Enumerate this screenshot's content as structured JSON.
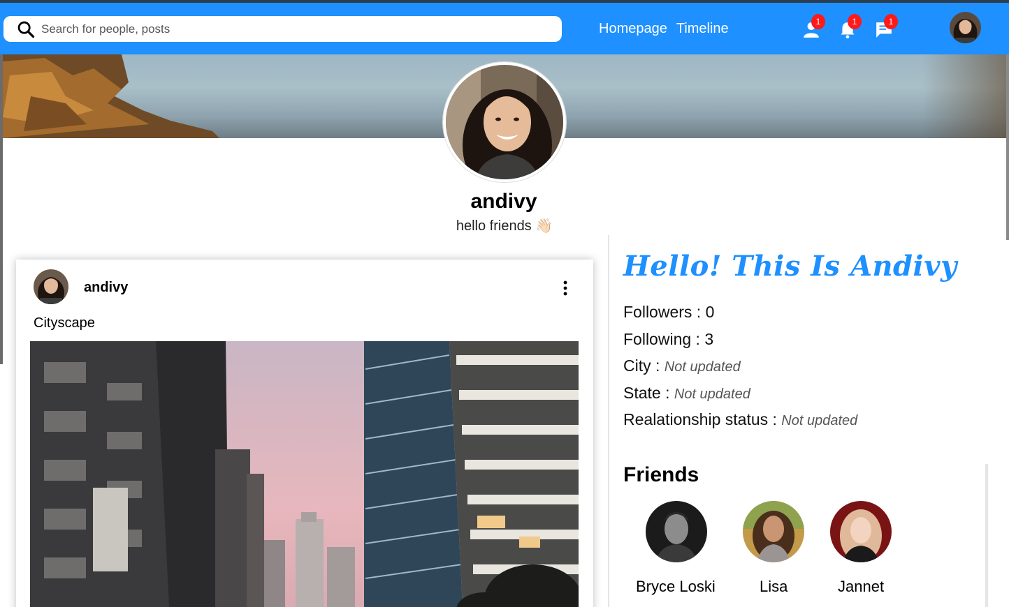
{
  "search": {
    "placeholder": "Search for people, posts"
  },
  "nav": {
    "links": [
      "Homepage",
      "Timeline"
    ],
    "badges": {
      "friend_requests": "1",
      "notifications": "1",
      "messages": "1"
    }
  },
  "profile": {
    "name": "andivy",
    "description": "hello friends 👋🏻"
  },
  "post": {
    "username": "andivy",
    "text": "Cityscape"
  },
  "about": {
    "heading": "Hello! This Is Andivy",
    "followers_label": "Followers : ",
    "followers": "0",
    "following_label": "Following : ",
    "following": "3",
    "city_label": "City : ",
    "city": "Not updated",
    "state_label": "State : ",
    "state": "Not updated",
    "relationship_label": "Realationship status : ",
    "relationship": "Not updated"
  },
  "friends": {
    "title": "Friends",
    "list": [
      {
        "name": "Bryce Loski"
      },
      {
        "name": "Lisa"
      },
      {
        "name": "Jannet"
      }
    ]
  },
  "colors": {
    "accent": "#1e90ff",
    "badge": "#ff1a1a"
  }
}
